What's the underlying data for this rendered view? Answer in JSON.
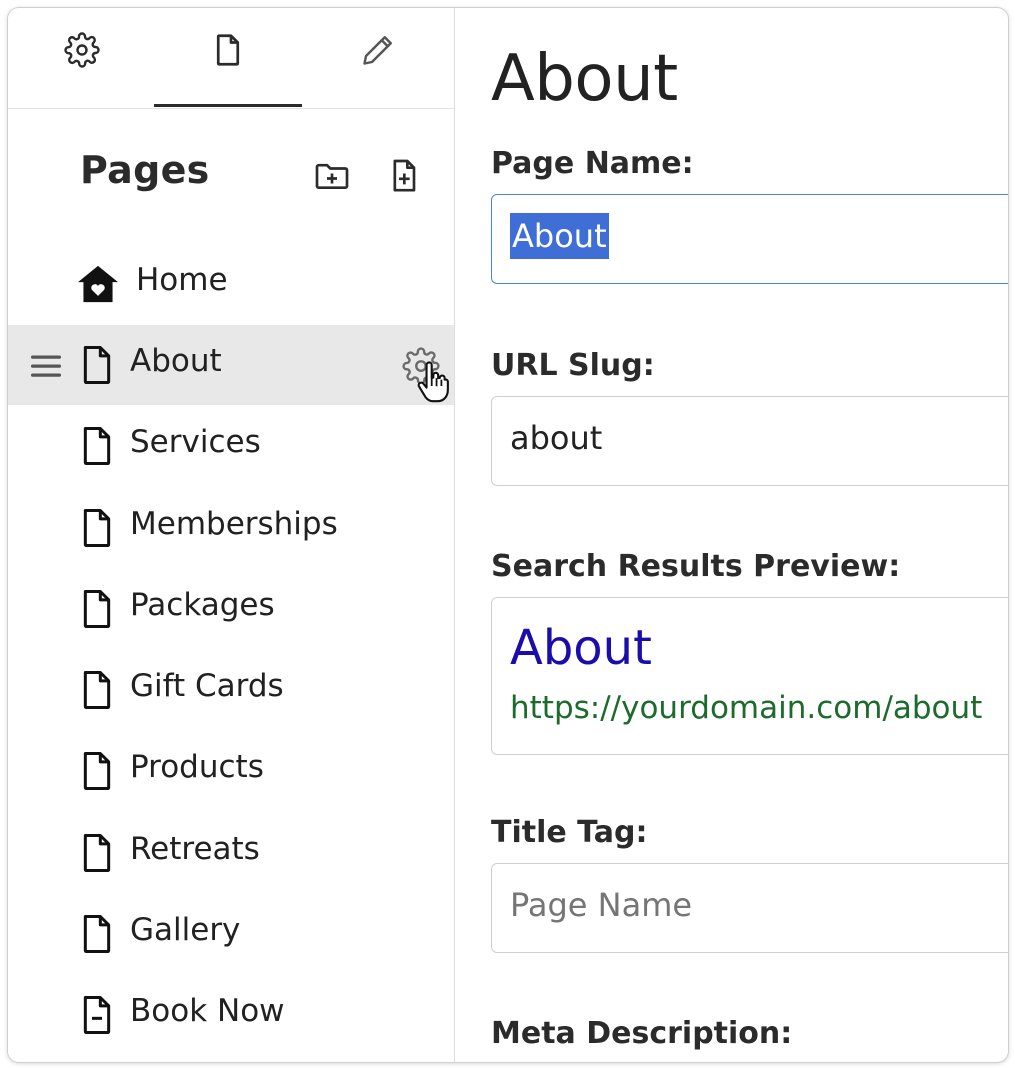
{
  "sidebar": {
    "tabs": [
      {
        "name": "settings",
        "icon": "gear-icon",
        "active": false
      },
      {
        "name": "pages",
        "icon": "document-icon",
        "active": true
      },
      {
        "name": "edit",
        "icon": "pencil-icon",
        "active": false
      }
    ],
    "title": "Pages",
    "header_buttons": [
      {
        "icon": "folder-plus-icon"
      },
      {
        "icon": "document-plus-icon"
      }
    ],
    "pages": [
      {
        "label": "Home",
        "icon": "home-heart-icon"
      },
      {
        "label": "About",
        "icon": "document-icon",
        "selected": true
      },
      {
        "label": "Services",
        "icon": "document-icon"
      },
      {
        "label": "Memberships",
        "icon": "document-icon"
      },
      {
        "label": "Packages",
        "icon": "document-icon"
      },
      {
        "label": "Gift Cards",
        "icon": "document-icon"
      },
      {
        "label": "Products",
        "icon": "document-icon"
      },
      {
        "label": "Retreats",
        "icon": "document-icon"
      },
      {
        "label": "Gallery",
        "icon": "document-icon"
      },
      {
        "label": "Book Now",
        "icon": "document-minus-icon"
      }
    ]
  },
  "main": {
    "title": "About",
    "page_name": {
      "label": "Page Name:",
      "value": "About"
    },
    "url_slug": {
      "label": "URL Slug:",
      "value": "about"
    },
    "search_preview": {
      "label": "Search Results Preview:",
      "title": "About",
      "url": "https://yourdomain.com/about"
    },
    "title_tag": {
      "label": "Title Tag:",
      "placeholder": "Page Name"
    },
    "meta_description": {
      "label": "Meta Description:"
    }
  },
  "colors": {
    "selected_row": "#e8e8e8",
    "focus_border": "#4a86d6",
    "text_selection": "#3f6fd6",
    "preview_title": "#1a0dab",
    "preview_url": "#1d6b2c"
  }
}
